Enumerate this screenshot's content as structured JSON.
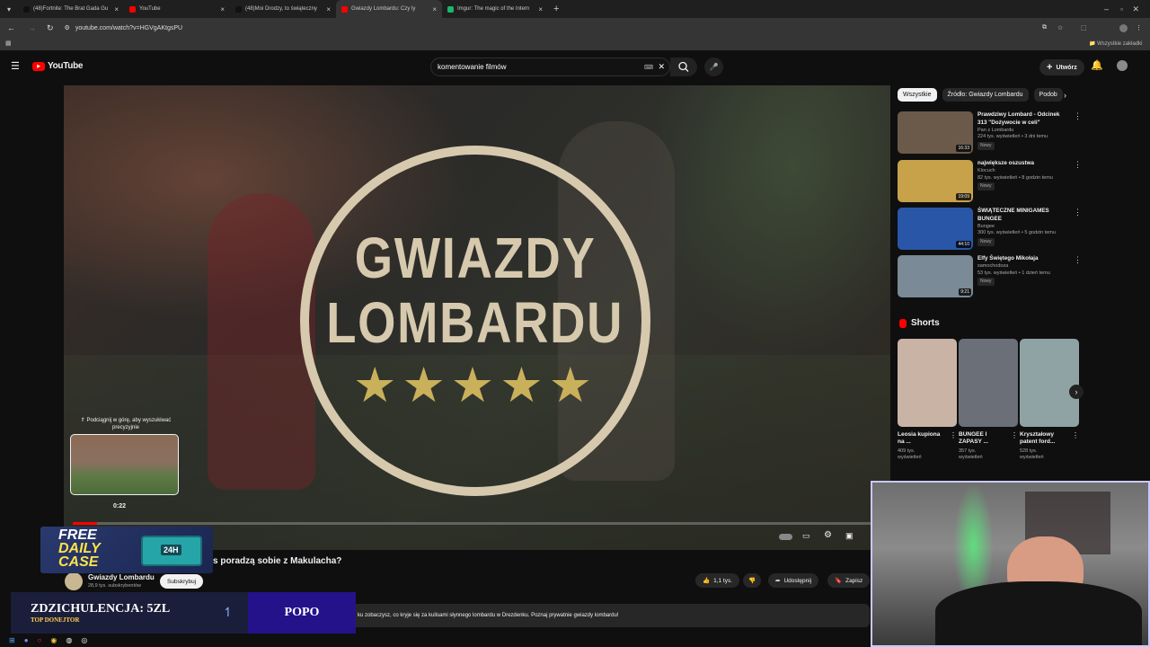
{
  "tabs": [
    {
      "label": "(48)Fortnite: The Brat Gada Gu",
      "color": "#111111",
      "active": false
    },
    {
      "label": "YouTube",
      "color": "#ff0000",
      "active": false
    },
    {
      "label": "(48)Moi Drodzy, to świąteczny",
      "color": "#111111",
      "active": false
    },
    {
      "label": "Gwiazdy Lombardu: Czy ly",
      "color": "#ff0000",
      "active": true
    },
    {
      "label": "Imgur: The magic of the Intern",
      "color": "#1bb76e",
      "active": false
    }
  ],
  "browser": {
    "url": "youtube.com/watch?v=HGVgAKtgsPU",
    "bookmarks_label": "Wszystkie zakładki"
  },
  "yt": {
    "logo": "YouTube",
    "search_value": "komentowanie filmów",
    "create_label": "Utwórz"
  },
  "video": {
    "overlay_line1": "GWIAZDY",
    "overlay_line2": "LOMBARDU",
    "stars": "★★★★★",
    "seek_hint": "⇑ Podciągnij w górę, aby wyszukiwać precyzyjnie",
    "seek_time": "0:22",
    "title": "s poradzą sobie z Makulacha?",
    "channel": "Gwiazdy Lombardu",
    "subs": "28,9 tys. subskrybentów",
    "subscribe": "Subskrybuj",
    "likes": "1,1 tys.",
    "share": "Udostępnij",
    "save": "Zapisz",
    "description": "ku zobaczysz, co kryje się za kulisami słynnego lombardu w Drezdenku. Poznaj prywatnie gwiazdy lombardu!"
  },
  "chips": [
    "Wszystkie",
    "Źródło: Gwiazdy Lombardu",
    "Podob"
  ],
  "recommended": [
    {
      "title": "Prawdziwy Lombard - Odcinek 313 \"Dożywocie w celi\"",
      "channel": "Pan z Lombardu",
      "meta": "224 tys. wyświetleń • 3 dni temu",
      "badge": "Nowy",
      "duration": "16:33",
      "color": "#6b5a4a"
    },
    {
      "title": "największe oszustwa",
      "channel": "Klocuch",
      "meta": "82 tys. wyświetleń • 8 godzin temu",
      "badge": "Nowy",
      "duration": "19:09",
      "color": "#c8a24a"
    },
    {
      "title": "ŚWIĄTECZNE MINIGAMES BUNGEE",
      "channel": "Bungee",
      "meta": "300 tys. wyświetleń • 5 godzin temu",
      "badge": "Nowy",
      "duration": "44:10",
      "color": "#2a56a8"
    },
    {
      "title": "Elfy Świętego Mikołaja",
      "channel": "samochodoza",
      "meta": "53 tys. wyświetleń • 1 dzień temu",
      "badge": "Nowy",
      "duration": "9:21",
      "color": "#7a8a96"
    }
  ],
  "shorts_heading": "Shorts",
  "shorts": [
    {
      "title": "Leosia kupiona na ...",
      "views": "409 tys.",
      "suffix": "wyświetleń",
      "color": "#c9b3a5"
    },
    {
      "title": "BUNGEE I ZAPASY ...",
      "views": "357 tys.",
      "suffix": "wyświetleń",
      "color": "#6a6f78"
    },
    {
      "title": "Kryształowy patent ford...",
      "views": "528 tys.",
      "suffix": "wyświetleń",
      "color": "#8fa3a5"
    }
  ],
  "stream": {
    "case_line1": "FREE",
    "case_line2": "DAILY",
    "case_line3": "CASE",
    "donation_title": "ZDZICHULENCJA: 5ZL",
    "donation_sub": "TOP DONEJTOR",
    "donor_label": "POPO",
    "time_badge": "24H"
  }
}
